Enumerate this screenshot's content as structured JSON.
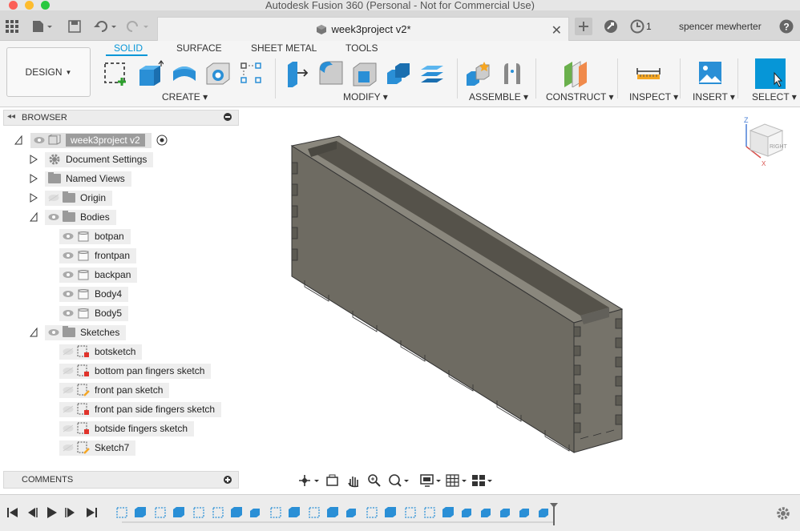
{
  "window": {
    "title": "Autodesk Fusion 360 (Personal - Not for Commercial Use)"
  },
  "tabbar": {
    "document_tab": "week3project v2*",
    "job_count": "1",
    "user": "spencer mewherter"
  },
  "ribbon": {
    "workspace": "DESIGN",
    "tabs": [
      "SOLID",
      "SURFACE",
      "SHEET METAL",
      "TOOLS"
    ],
    "active_tab": "SOLID",
    "groups": [
      "CREATE",
      "MODIFY",
      "ASSEMBLE",
      "CONSTRUCT",
      "INSPECT",
      "INSERT",
      "SELECT"
    ],
    "accent": "#0696d7"
  },
  "browser": {
    "title": "BROWSER",
    "root": "week3project v2",
    "items": [
      {
        "label": "Document Settings"
      },
      {
        "label": "Named Views"
      },
      {
        "label": "Origin"
      },
      {
        "label": "Bodies"
      },
      {
        "label": "botpan"
      },
      {
        "label": "frontpan"
      },
      {
        "label": "backpan"
      },
      {
        "label": "Body4"
      },
      {
        "label": "Body5"
      },
      {
        "label": "Sketches"
      },
      {
        "label": "botsketch"
      },
      {
        "label": "bottom pan fingers sketch"
      },
      {
        "label": "front pan sketch"
      },
      {
        "label": "front pan side fingers sketch"
      },
      {
        "label": "botside fingers sketch"
      },
      {
        "label": "Sketch7"
      }
    ]
  },
  "comments": {
    "title": "COMMENTS"
  },
  "viewcube": {
    "face_label": "RIGHT",
    "axis_z": "Z",
    "axis_x": "X"
  }
}
